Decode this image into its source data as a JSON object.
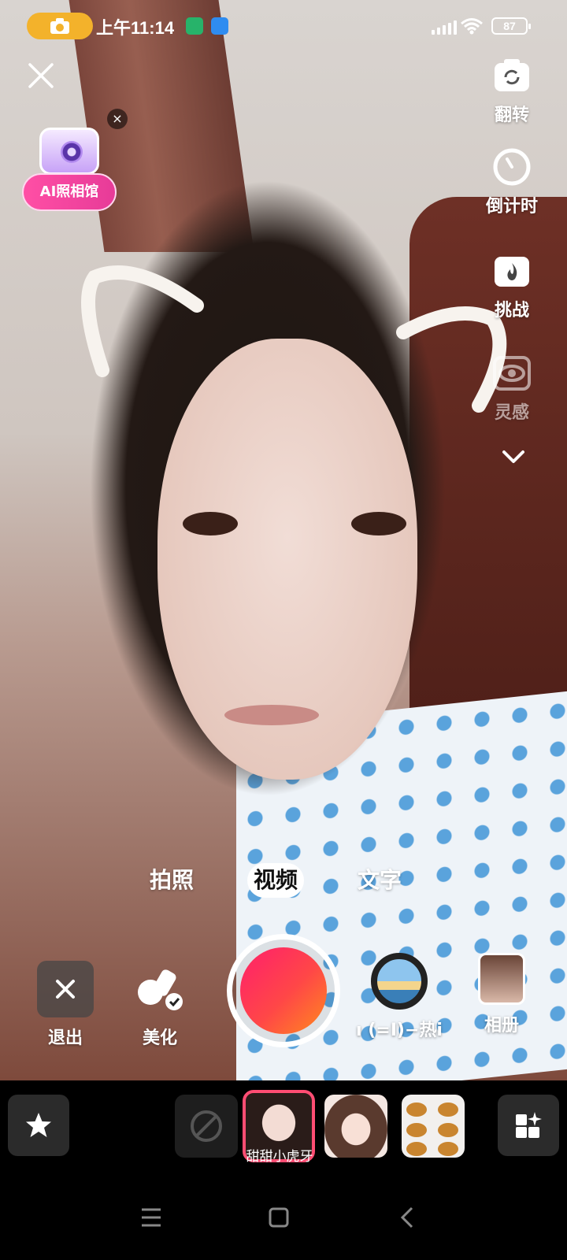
{
  "status_bar": {
    "time": "上午11:14",
    "battery": "87"
  },
  "ai_studio": {
    "label": "AI照相馆",
    "dismiss": "×"
  },
  "tools": [
    {
      "label": "翻转",
      "icon": "flip-camera-icon"
    },
    {
      "label": "倒计时",
      "icon": "timer-icon"
    },
    {
      "label": "挑战",
      "icon": "challenge-icon"
    },
    {
      "label": "灵感",
      "icon": "inspiration-icon"
    }
  ],
  "modes": {
    "items": [
      "拍照",
      "视频",
      "文字"
    ],
    "active": "视频"
  },
  "capture_row": {
    "exit_label": "退出",
    "beauty_label": "美化",
    "hot_label": "ı (=I)−热i",
    "album_label": "相册"
  },
  "effects": {
    "selected_name": "甜甜小虎牙"
  },
  "colors": {
    "accent": "#ff2d5f",
    "shutter_end": "#ff8a1e",
    "selected_border": "#ff4d73",
    "ai_pink": "#ff4fa5",
    "rec_pill": "#f3b22b"
  }
}
